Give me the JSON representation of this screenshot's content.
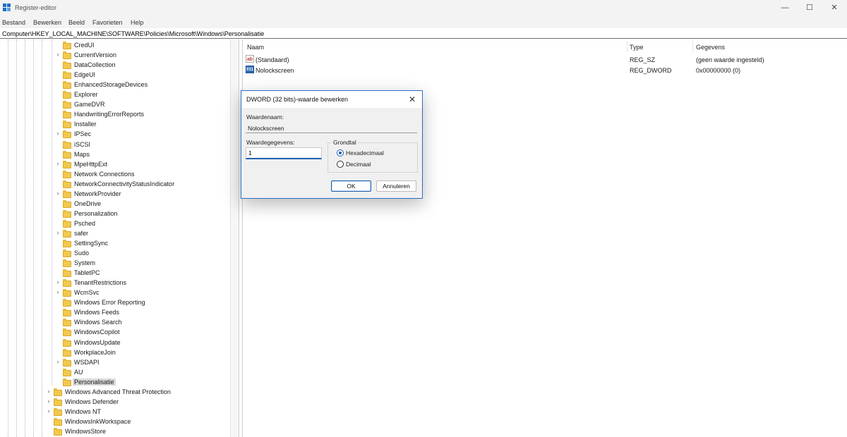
{
  "window": {
    "title": "Register-editor",
    "controls": [
      "—",
      "☐",
      "✕"
    ]
  },
  "menu": [
    "Bestand",
    "Bewerken",
    "Beeld",
    "Favorieten",
    "Help"
  ],
  "address": "Computer\\HKEY_LOCAL_MACHINE\\SOFTWARE\\Policies\\Microsoft\\Windows\\Personalisatie",
  "tree": {
    "windows_children": [
      {
        "label": "CredUI",
        "expandable": false
      },
      {
        "label": "CurrentVersion",
        "expandable": true
      },
      {
        "label": "DataCollection",
        "expandable": false
      },
      {
        "label": "EdgeUI",
        "expandable": false
      },
      {
        "label": "EnhancedStorageDevices",
        "expandable": false
      },
      {
        "label": "Explorer",
        "expandable": false
      },
      {
        "label": "GameDVR",
        "expandable": false
      },
      {
        "label": "HandwritingErrorReports",
        "expandable": false
      },
      {
        "label": "Installer",
        "expandable": false
      },
      {
        "label": "IPSec",
        "expandable": true
      },
      {
        "label": "iSCSI",
        "expandable": false
      },
      {
        "label": "Maps",
        "expandable": false
      },
      {
        "label": "MpeHttpExt",
        "expandable": true
      },
      {
        "label": "Network Connections",
        "expandable": false
      },
      {
        "label": "NetworkConnectivityStatusIndicator",
        "expandable": false
      },
      {
        "label": "NetworkProvider",
        "expandable": true
      },
      {
        "label": "OneDrive",
        "expandable": false
      },
      {
        "label": "Personalization",
        "expandable": false
      },
      {
        "label": "Psched",
        "expandable": false
      },
      {
        "label": "safer",
        "expandable": true
      },
      {
        "label": "SettingSync",
        "expandable": false
      },
      {
        "label": "Sudo",
        "expandable": false
      },
      {
        "label": "System",
        "expandable": false
      },
      {
        "label": "TabletPC",
        "expandable": false
      },
      {
        "label": "TenantRestrictions",
        "expandable": true
      },
      {
        "label": "WcmSvc",
        "expandable": true
      },
      {
        "label": "Windows Error Reporting",
        "expandable": false
      },
      {
        "label": "Windows Feeds",
        "expandable": false
      },
      {
        "label": "Windows Search",
        "expandable": false
      },
      {
        "label": "WindowsCopilot",
        "expandable": false
      },
      {
        "label": "WindowsUpdate",
        "expandable": false
      },
      {
        "label": "WorkplaceJoin",
        "expandable": false
      },
      {
        "label": "WSDAPI",
        "expandable": true
      },
      {
        "label": "AU",
        "expandable": false
      },
      {
        "label": "Personalisatie",
        "expandable": false,
        "selected": true
      }
    ],
    "microsoft_children": [
      {
        "label": "Windows Advanced Threat Protection",
        "expandable": true
      },
      {
        "label": "Windows Defender",
        "expandable": true
      },
      {
        "label": "Windows NT",
        "expandable": true
      },
      {
        "label": "WindowsInkWorkspace",
        "expandable": false
      },
      {
        "label": "WindowsStore",
        "expandable": false
      }
    ]
  },
  "list": {
    "columns": {
      "name": "Naam",
      "type": "Type",
      "data": "Gegevens"
    },
    "rows": [
      {
        "icon": "ab",
        "name": "(Standaard)",
        "type": "REG_SZ",
        "data": "(geen waarde ingesteld)"
      },
      {
        "icon": "011",
        "name": "Nolockscreen",
        "type": "REG_DWORD",
        "data": "0x00000000 (0)"
      }
    ]
  },
  "dialog": {
    "title": "DWORD (32 bits)-waarde bewerken",
    "name_label": "Waardenaam:",
    "name_value": "Nolockscreen",
    "data_label": "Waardegegevens:",
    "data_value": "1",
    "base_label": "Grondtal",
    "base_options": [
      "Hexadecimaal",
      "Decimaal"
    ],
    "base_selected": "Hexadecimaal",
    "ok": "OK",
    "cancel": "Annuleren"
  },
  "colors": {
    "accent": "#1f5fb0",
    "folder": "#f2c94c"
  }
}
